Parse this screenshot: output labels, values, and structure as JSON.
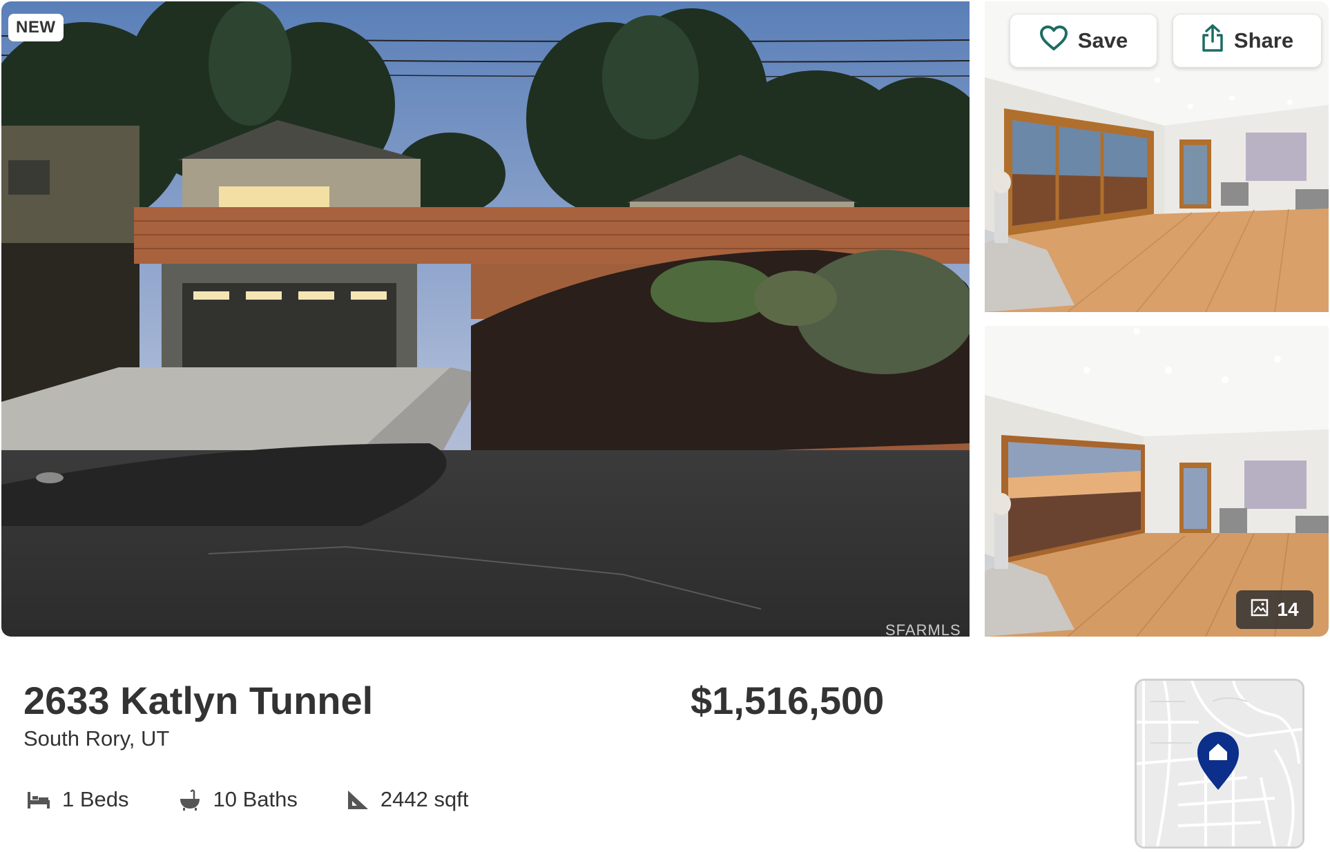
{
  "listing": {
    "badge": "NEW",
    "address": "2633 Katlyn Tunnel",
    "locality": "South Rory, UT",
    "price": "$1,516,500",
    "beds": "1 Beds",
    "baths": "10 Baths",
    "sqft": "2442 sqft"
  },
  "gallery": {
    "save_label": "Save",
    "share_label": "Share",
    "photo_count": "14",
    "watermark": "SFARMLS"
  },
  "icons": {
    "save": "heart-icon",
    "share": "share-icon",
    "photos": "image-icon",
    "beds": "bed-icon",
    "baths": "bathtub-icon",
    "sqft": "ruler-triangle-icon",
    "map": "location-pin-icon"
  },
  "colors": {
    "accent": "#1d6b63",
    "text": "#333333",
    "map_pin": "#0b2f8a"
  }
}
